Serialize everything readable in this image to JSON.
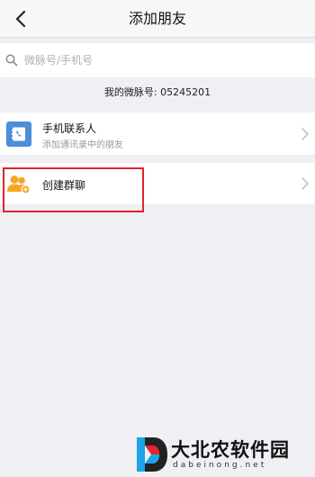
{
  "navbar": {
    "title": "添加朋友",
    "back_icon": "chevron-left-icon"
  },
  "search": {
    "placeholder": "微脉号/手机号",
    "value": "",
    "icon": "search-icon"
  },
  "my_id": {
    "text": "我的微脉号: 05245201"
  },
  "cells": [
    {
      "title": "手机联系人",
      "subtitle": "添加通讯录中的朋友",
      "icon": "phone-contacts-icon",
      "icon_color": "#4a8fd7"
    },
    {
      "title": "创建群聊",
      "icon": "group-chat-icon",
      "icon_color": "#f5a623"
    }
  ],
  "highlight": {
    "color": "#e0242b"
  },
  "watermark": {
    "brand": "大北农软件园",
    "domain": "dabeinong.net"
  }
}
